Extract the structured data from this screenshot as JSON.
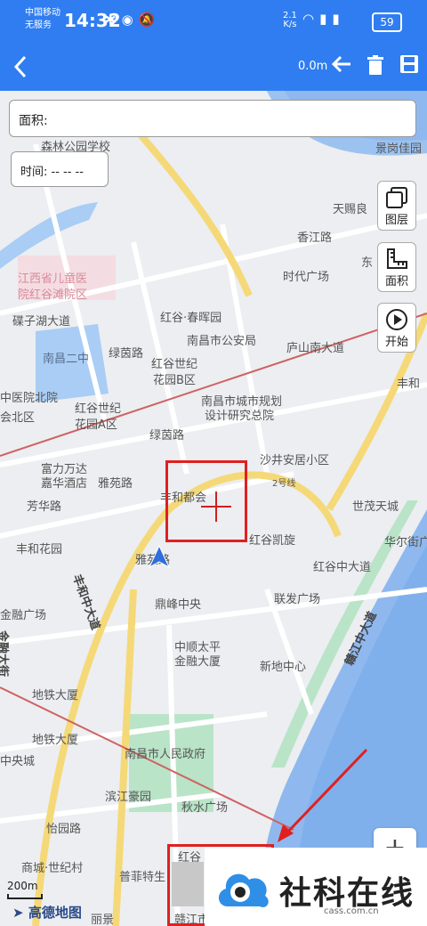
{
  "status_bar": {
    "carrier_line1": "中国移动",
    "carrier_line2": "无服务",
    "time": "14:32",
    "net_speed_value": "2.1",
    "net_speed_unit": "K/s",
    "battery": "59"
  },
  "app_bar": {
    "distance": "0.0m"
  },
  "overlays": {
    "area_label": "面积:",
    "time_label": "时间: -- -- --"
  },
  "tools": [
    {
      "label": "图层",
      "icon": "layers-icon"
    },
    {
      "label": "面积",
      "icon": "ruler-icon"
    },
    {
      "label": "开始",
      "icon": "play-icon"
    }
  ],
  "map": {
    "labels": {
      "l1": "森林公园学校",
      "l2": "景岗佳园",
      "l3": "天赐良",
      "l4": "香江路",
      "l5": "东",
      "l6": "时代广场",
      "l7": "江西省儿童医",
      "l8": "院红谷滩院区",
      "l9": "碟子湖大道",
      "l10": "南昌二中",
      "l11": "红谷·春晖园",
      "l12": "南昌市公安局",
      "l13": "庐山南大道",
      "l14": "红谷世纪",
      "l15": "花园B区",
      "l16": "绿茵路",
      "l17": "南昌市城市规划",
      "l18": "设计研究总院",
      "l19": "中医院北院",
      "l20": "红谷世纪",
      "l21": "花园A区",
      "l22": "会北区",
      "l23": "绿茵路",
      "l24": "沙井安居小区",
      "l25": "富力万达",
      "l26": "嘉华酒店",
      "l27": "丰和都会",
      "l28": "雅苑路",
      "l29": "芳华路",
      "l30": "世茂天城",
      "l31": "丰和花园",
      "l32": "红谷凯旋",
      "l33": "华尔街广",
      "l34": "红谷中大道",
      "l35": "雅苑路",
      "l36": "联发广场",
      "l37": "鼎峰中央",
      "l38": "金融广场",
      "l39": "丰和中大道",
      "l40": "中顺太平",
      "l41": "金融大厦",
      "l42": "新地中心",
      "l43": "赣江中大道",
      "l44": "地铁大厦",
      "l45": "地铁大厦",
      "l46": "南昌市人民政府",
      "l47": "中央城",
      "l48": "滨江豪园",
      "l49": "秋水广场",
      "l50": "怡园路",
      "l51": "商城·世纪村",
      "l52": "普菲特生",
      "l53": "丽景",
      "l54": "赣江市",
      "l55": "红谷",
      "l56": "丰和",
      "l57": "金融大街",
      "l58": "2号线"
    },
    "scale": "200m",
    "logo": "高德地图",
    "zoom_in": "+"
  },
  "watermark": {
    "text": "社科在线",
    "sub": "cass.com.cn"
  },
  "colors": {
    "appbar": "#2f7df0",
    "annotation": "#e02020",
    "river": "#8fb8ee",
    "park": "#b9e4c7",
    "road_major": "#f5d978"
  }
}
